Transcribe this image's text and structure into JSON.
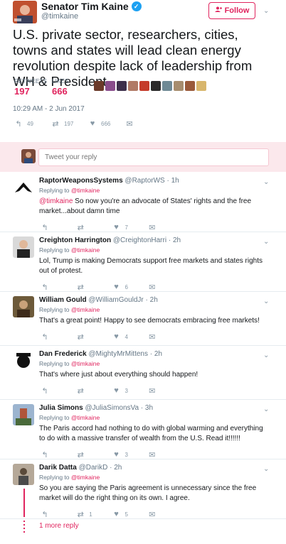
{
  "main_tweet": {
    "author": {
      "name": "Senator Tim Kaine",
      "handle": "@timkaine"
    },
    "follow_label": "Follow",
    "text": "U.S. private sector, researchers, cities, towns and states will lead clean energy revolution despite lack of leadership from WH & President",
    "retweets": {
      "label": "RETWEETS",
      "value": "197"
    },
    "likes": {
      "label": "LIKES",
      "value": "666"
    },
    "timestamp": "10:29 AM - 2 Jun 2017",
    "actions": {
      "replies": "49",
      "retweets": "197",
      "likes": "666"
    },
    "liker_colors": [
      "#6b3a2a",
      "#8a4d8c",
      "#3d2f4b",
      "#b17a66",
      "#c53b2a",
      "#2a2a2a",
      "#6f8a95",
      "#a78d6e",
      "#9a5a3a",
      "#d8b66c"
    ]
  },
  "composer": {
    "placeholder": "Tweet your reply"
  },
  "replies": [
    {
      "name": "RaptorWeaponsSystems",
      "handle": "@RaptorWS",
      "time": "· 1h",
      "replying_label": "Replying to",
      "replying_to": "@timkaine",
      "mention": "@timkaine",
      "text": " So now you're an advocate of States' rights and the free market...about damn time",
      "likes": "7",
      "avatar": "#ffffff"
    },
    {
      "name": "Creighton Harrington",
      "handle": "@CreightonHarri",
      "time": "· 2h",
      "replying_label": "Replying to",
      "replying_to": "@timkaine",
      "text": "Lol, Trump is making Democrats support free markets and states rights out of protest.",
      "likes": "6",
      "avatar": "#3b3b3b"
    },
    {
      "name": "William Gould",
      "handle": "@WilliamGouldJr",
      "time": "· 2h",
      "replying_label": "Replying to",
      "replying_to": "@timkaine",
      "text": "That's a great point! Happy to see democrats embracing free markets!",
      "likes": "4",
      "avatar": "#6d5a3a"
    },
    {
      "name": "Dan Frederick",
      "handle": "@MightyMrMittens",
      "time": "· 2h",
      "replying_label": "Replying to",
      "replying_to": "@timkaine",
      "text": "That's where just about everything should happen!",
      "likes": "3",
      "avatar": "#ffffff"
    },
    {
      "name": "Julia Simons",
      "handle": "@JuliaSimonsVa",
      "time": "· 3h",
      "replying_label": "Replying to",
      "replying_to": "@timkaine",
      "text": "The Paris accord had nothing to do with global warming and everything to do with a massive transfer of wealth from the U.S. Read it!!!!!!",
      "likes": "3",
      "avatar": "#8aa0b8"
    },
    {
      "name": "Darik Datta",
      "handle": "@DarikD",
      "time": "· 2h",
      "replying_label": "Replying to",
      "replying_to": "@timkaine",
      "text": "So you are saying the Paris agreement is unnecessary since the free market will do the right thing on its own. I agree.",
      "retweets": "1",
      "likes": "5",
      "avatar": "#9a8a7a"
    }
  ],
  "more_reply": "1 more reply",
  "icons": {
    "reply": "reply-icon",
    "retweet": "retweet-icon",
    "like": "heart-icon",
    "dm": "envelope-icon",
    "more": "chevron-down-icon"
  }
}
